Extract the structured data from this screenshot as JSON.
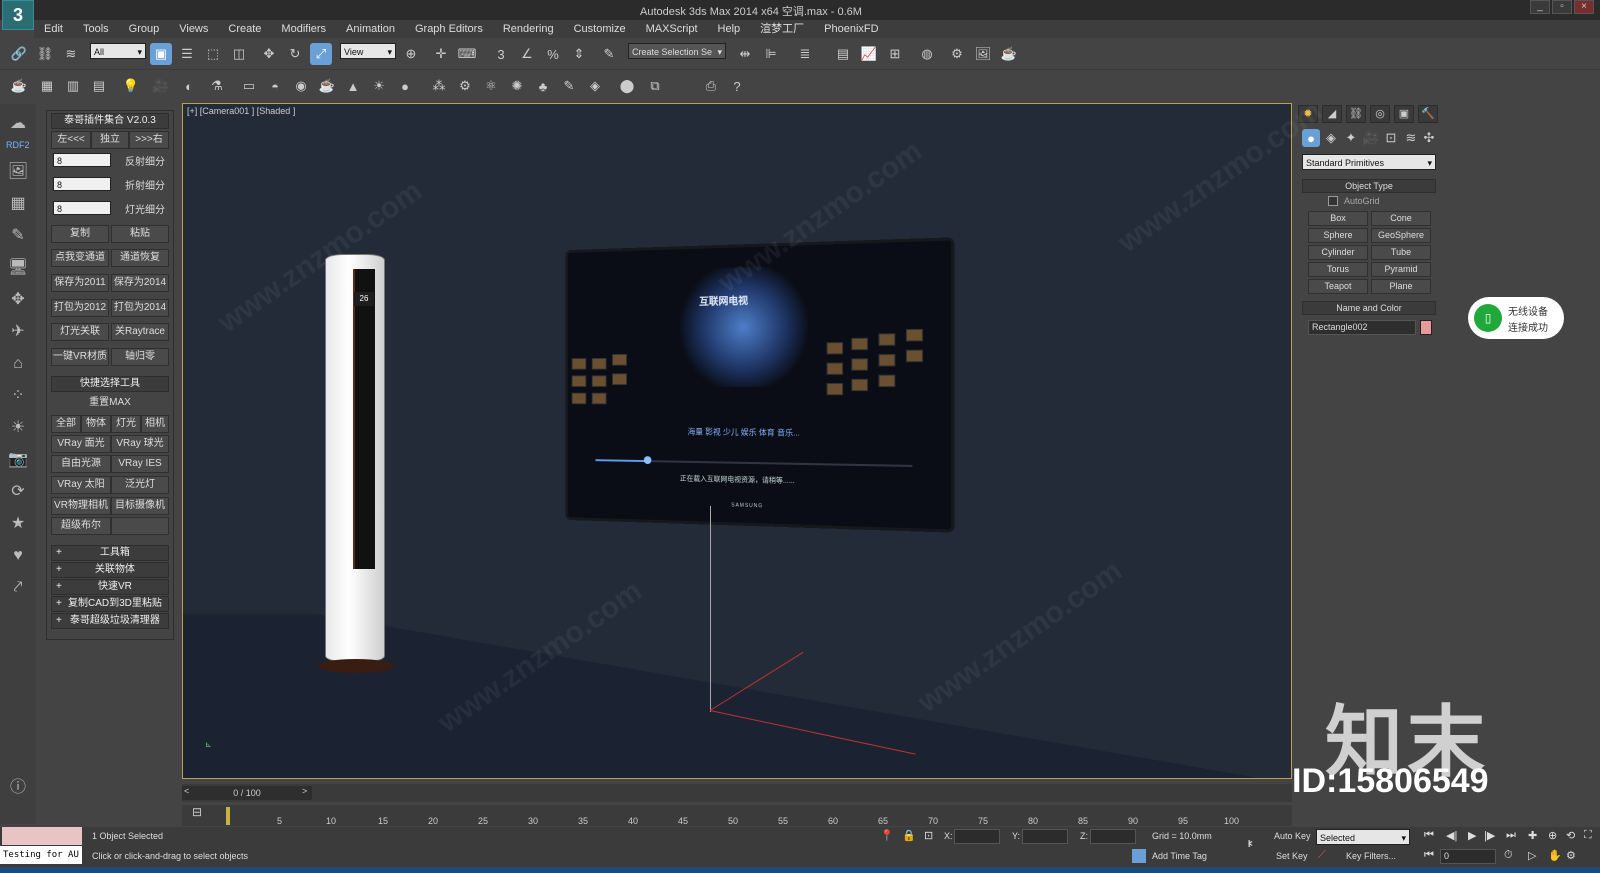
{
  "window": {
    "title": "Autodesk 3ds Max  2014 x64     空调.max - 0.6M",
    "logo_text": "3"
  },
  "menu": [
    "Edit",
    "Tools",
    "Group",
    "Views",
    "Create",
    "Modifiers",
    "Animation",
    "Graph Editors",
    "Rendering",
    "Customize",
    "MAXScript",
    "Help",
    "渲梦工厂",
    "PhoenixFD"
  ],
  "toolbar": {
    "filter_select": "All",
    "ref_coord": "View",
    "named_sel": "Create Selection Se"
  },
  "left_label": "RDF2",
  "plugin": {
    "title": "泰哥插件集合 V2.0.3",
    "row1": [
      "左<<<",
      "独立",
      ">>>右"
    ],
    "spinners": [
      {
        "value": "8",
        "label": "反射细分"
      },
      {
        "value": "8",
        "label": "折射细分"
      },
      {
        "value": "8",
        "label": "灯光细分"
      }
    ],
    "buttons": [
      [
        "复制",
        "粘贴"
      ],
      [
        "点我变通道",
        "通道恢复"
      ],
      [
        "保存为2011",
        "保存为2014"
      ],
      [
        "打包为2012",
        "打包为2014"
      ],
      [
        "灯光关联",
        "关Raytrace"
      ],
      [
        "一键VR材质",
        "轴归零"
      ]
    ],
    "quick_title": "快捷选择工具",
    "reset": "重置MAX",
    "quick_row": [
      "全部",
      "物体",
      "灯光",
      "相机"
    ],
    "quick_buttons": [
      [
        "VRay 面光",
        "VRay 球光"
      ],
      [
        "自由光源",
        "VRay IES"
      ],
      [
        "VRay 太阳",
        "泛光灯"
      ],
      [
        "VR物理相机",
        "目标摄像机"
      ],
      [
        "超级布尔",
        ""
      ]
    ],
    "collapsed": [
      "工具箱",
      "关联物体",
      "快速VR",
      "复制CAD到3D里粘贴",
      "泰哥超级垃圾清理器"
    ]
  },
  "viewport": {
    "label": "[+] [Camera001 ] [Shaded ]",
    "tv_title": "互联网电视",
    "tv_categories": "海量  影视  少儿  娱乐  体育  音乐...",
    "tv_loading": "正在载入互联网电视资源，请稍等......",
    "tv_brand": "SAMSUNG",
    "ac_display": "26"
  },
  "command_panel": {
    "category": "Standard Primitives",
    "object_type": "Object Type",
    "autogrid": "AutoGrid",
    "buttons": [
      [
        "Box",
        "Cone"
      ],
      [
        "Sphere",
        "GeoSphere"
      ],
      [
        "Cylinder",
        "Tube"
      ],
      [
        "Torus",
        "Pyramid"
      ],
      [
        "Teapot",
        "Plane"
      ]
    ],
    "name_color": "Name and Color",
    "object_name": "Rectangle002",
    "object_color": "#e89a9a"
  },
  "notification": {
    "line1": "无线设备",
    "line2": "连接成功"
  },
  "watermark": {
    "brand": "知末",
    "id": "ID:15806549",
    "site": "www.znzmo.com"
  },
  "timeline": {
    "frame": "0 / 100",
    "ticks": [
      "5",
      "10",
      "15",
      "20",
      "25",
      "30",
      "35",
      "40",
      "45",
      "50",
      "55",
      "60",
      "65",
      "70",
      "75",
      "80",
      "85",
      "90",
      "95",
      "100"
    ]
  },
  "status": {
    "selected": "1 Object Selected",
    "prompt": "Click or click-and-drag to select objects",
    "x_label": "X:",
    "y_label": "Y:",
    "z_label": "Z:",
    "grid": "Grid = 10.0mm",
    "add_time_tag": "Add Time Tag",
    "auto_key": "Auto Key",
    "set_key": "Set Key",
    "key_mode": "Selected",
    "key_filters": "Key Filters...",
    "frame_field": "0",
    "script": "Testing for AU"
  }
}
